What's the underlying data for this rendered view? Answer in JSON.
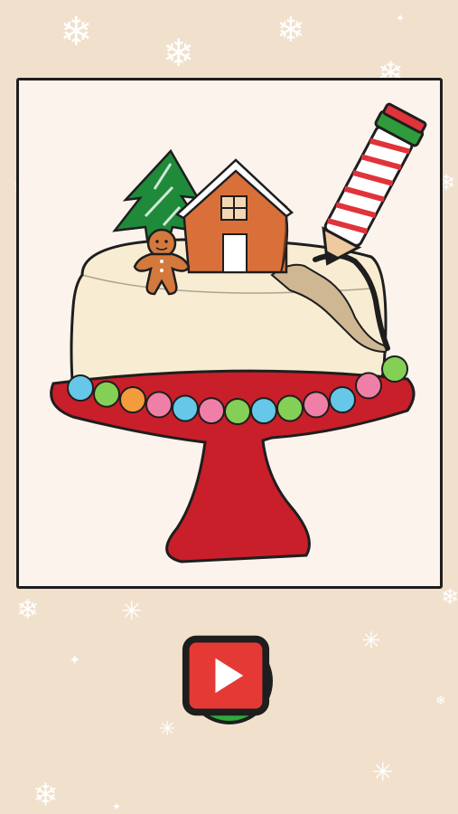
{
  "game": {
    "level_theme": "christmas-cake",
    "hint": {
      "icon": "lightbulb-icon",
      "badge_icon": "video-ad-icon"
    }
  },
  "colors": {
    "background": "#f1e0cc",
    "canvas": "#fbf3ec",
    "outline": "#1e1e1e",
    "cake_body": "#f8edd2",
    "cake_stand": "#c81f2a",
    "tree": "#1e8a3a",
    "house": "#d9703a",
    "gingerbread": "#d4793d",
    "hint_button": "#2eaa3c",
    "bulb": "#ffd83a",
    "pencil_stripe": "#e0333a",
    "pencil_cap": "#2f9b3b"
  },
  "drawing": {
    "gumballs": [
      "#66c7e8",
      "#84cf55",
      "#f39c3b",
      "#f07fa7",
      "#66c7e8",
      "#f07fa7",
      "#84cf55",
      "#66c7e8",
      "#84cf55",
      "#f07fa7",
      "#66c7e8",
      "#f07fa7",
      "#84cf55"
    ]
  }
}
